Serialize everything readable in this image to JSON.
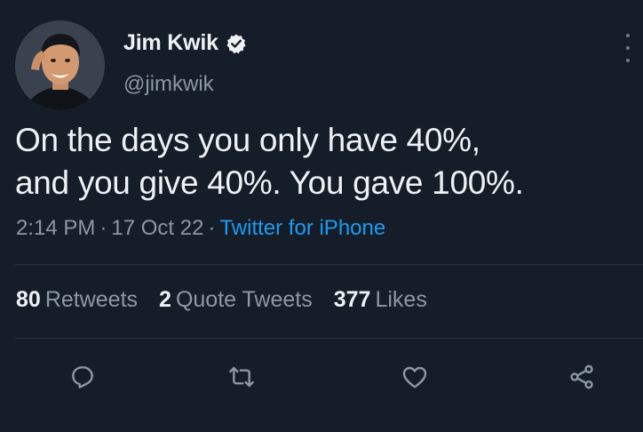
{
  "author": {
    "name": "Jim Kwik",
    "handle": "@jimkwik",
    "verified": true
  },
  "tweet": {
    "text_line1": "On the days you only have 40%,",
    "text_line2": "and you give 40%. You gave 100%."
  },
  "meta": {
    "time": "2:14 PM",
    "date": "17 Oct 22",
    "separator": "·",
    "source": "Twitter for iPhone"
  },
  "stats": [
    {
      "count": "80",
      "label": "Retweets"
    },
    {
      "count": "2",
      "label": "Quote Tweets"
    },
    {
      "count": "377",
      "label": "Likes"
    }
  ],
  "actions": {
    "reply_icon": "reply-icon",
    "retweet_icon": "retweet-icon",
    "like_icon": "heart-icon",
    "share_icon": "share-icon"
  },
  "colors": {
    "background": "#151d28",
    "text_primary": "#eef2f5",
    "text_secondary": "#8b98a5",
    "link": "#1d9bf0",
    "divider": "#2a3440"
  }
}
